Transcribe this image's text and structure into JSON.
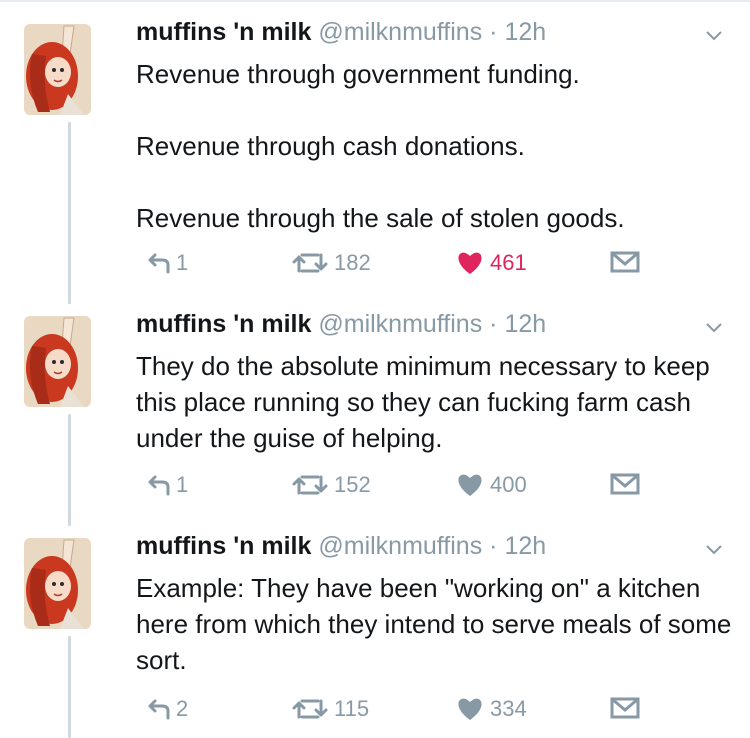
{
  "author": {
    "name": "muffins 'n milk",
    "handle": "@milknmuffins",
    "separator": "·"
  },
  "icons": {
    "reply": "reply-icon",
    "retweet": "retweet-icon",
    "like": "heart-icon",
    "dm": "envelope-icon",
    "menu": "chevron-down-icon"
  },
  "colors": {
    "like_active": "#e0245e",
    "muted": "#8899a6",
    "thread": "#d1d9de"
  },
  "tweets": [
    {
      "time": "12h",
      "paragraphs": [
        "Revenue through government funding.",
        "Revenue through cash donations.",
        "Revenue through the sale of stolen goods."
      ],
      "replies": "1",
      "retweets": "182",
      "likes": "461",
      "liked": true
    },
    {
      "time": "12h",
      "paragraphs": [
        "They do the absolute minimum necessary to keep this place running so they can fucking farm cash under the guise of helping."
      ],
      "replies": "1",
      "retweets": "152",
      "likes": "400",
      "liked": false
    },
    {
      "time": "12h",
      "paragraphs": [
        "Example: They have been \"working on\" a kitchen here from which they intend to serve meals of some sort."
      ],
      "replies": "2",
      "retweets": "115",
      "likes": "334",
      "liked": false
    }
  ]
}
